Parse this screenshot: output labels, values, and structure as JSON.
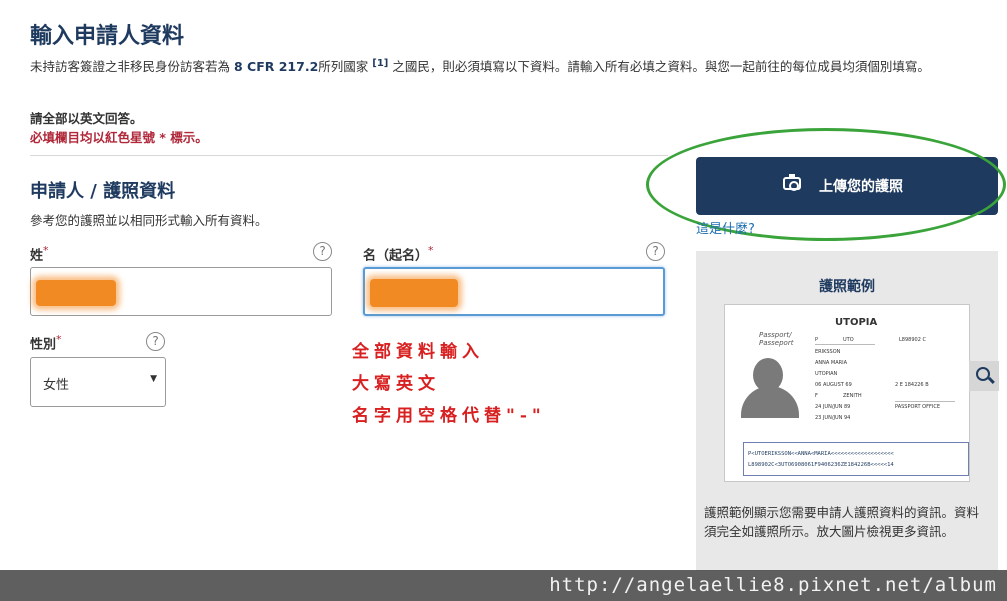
{
  "page": {
    "title": "輸入申請人資料",
    "intro_prefix": "未持訪客簽證之非移民身份訪客若為 ",
    "intro_cfr": "8 CFR 217.2",
    "intro_mid": "所列國家 ",
    "intro_ref": "[1]",
    "intro_suffix": " 之國民，則必須填寫以下資料。請輸入所有必填之資料。與您一起前往的每位成員均須個別填寫。",
    "english_note": "請全部以英文回答。",
    "required_note": "必填欄目均以紅色星號 * 標示。"
  },
  "section": {
    "title": "申請人 / 護照資料",
    "description": "參考您的護照並以相同形式輸入所有資料。"
  },
  "fields": {
    "surname_label": "姓",
    "given_name_label": "名（起名）",
    "gender_label": "性別",
    "required_mark": "*",
    "help_mark": "?",
    "gender_value": "女性",
    "select_arrow": "▼"
  },
  "annotation": {
    "line1": "全部資料輸入",
    "line2": "大寫英文",
    "line3": "名字用空格代替\"-\""
  },
  "upload": {
    "button_label": "上傳您的護照",
    "what_link": "這是什麼?"
  },
  "sample": {
    "title": "護照範例",
    "country": "UTOPIA",
    "passport_label": "Passport/\nPasseport",
    "surname": "ERIKSSON",
    "given_names": "ANNA MARIA",
    "nationality": "UTOPIAN",
    "dob": "06 AUGUST 69",
    "sex": "F",
    "place_of_birth": "ZENITH",
    "issue_date": "24 JUN/JUN 89",
    "authority": "PASSPORT OFFICE",
    "expiry_date": "23 JUN/JUN 94",
    "type": "P",
    "code": "UTO",
    "passport_no": "L898902 C",
    "personal_no": "2 E 184226 B",
    "mrz_line1": "P<UTOERIKSSON<<ANNA<MARIA<<<<<<<<<<<<<<<<<<<",
    "mrz_line2": "L898902C<3UTO6908061F9406236ZE184226B<<<<<14",
    "description": "護照範例顯示您需要申請人護照資料的資訊。資料須完全如護照所示。放大圖片檢視更多資訊。"
  },
  "watermark": {
    "text": "http://angelaellie8.pixnet.net/album"
  },
  "colors": {
    "brand_navy": "#1f3a5f",
    "required_red": "#b0283a",
    "annotation_red": "#d82020",
    "highlight_green": "#3aa43a",
    "redaction_orange": "#f28a24"
  }
}
